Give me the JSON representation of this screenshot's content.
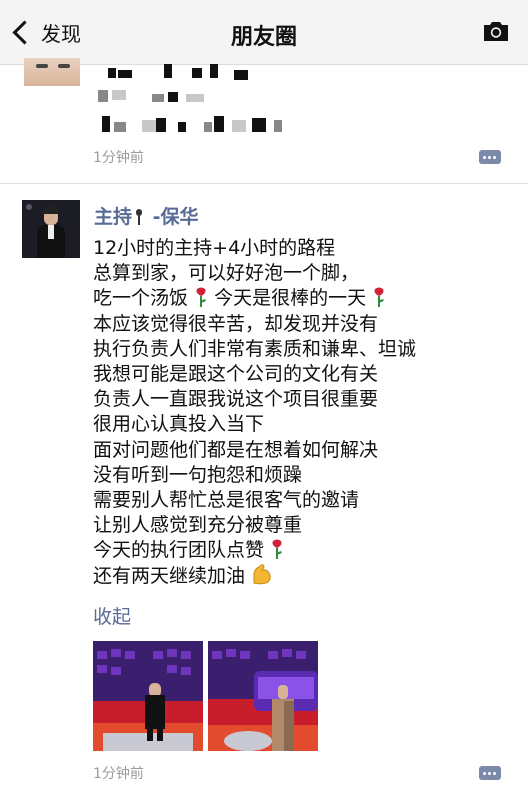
{
  "nav": {
    "back_label": "发现",
    "title": "朋友圈",
    "camera_icon": "camera-icon"
  },
  "posts": [
    {
      "time": "1分钟前"
    },
    {
      "author_prefix": "主持",
      "author_icon": "microphone-emoji",
      "author_suffix": " -保华",
      "lines": [
        "12小时的主持+4小时的路程",
        "总算到家，可以好好泡一个脚，",
        "吃一个汤饭",
        "今天是很棒的一天",
        "本应该觉得很辛苦，却发现并没有",
        "执行负责人们非常有素质和谦卑、坦诚",
        "我想可能是跟这个公司的文化有关",
        "负责人一直跟我说这个项目很重要",
        "很用心认真投入当下",
        "面对问题他们都是在想着如何解决",
        "没有听到一句抱怨和烦躁",
        "需要别人帮忙总是很客气的邀请",
        "让别人感觉到充分被尊重",
        "今天的执行团队点赞",
        "还有两天继续加油"
      ],
      "emojis": [
        "rose-emoji",
        "flexed-biceps-emoji"
      ],
      "collapse_label": "收起",
      "photos": [
        "stage-photo-1",
        "stage-photo-2"
      ],
      "time": "1分钟前"
    }
  ],
  "colors": {
    "link": "#576b95",
    "time": "#9b9b9b",
    "navbar": "#f4f4f4"
  }
}
